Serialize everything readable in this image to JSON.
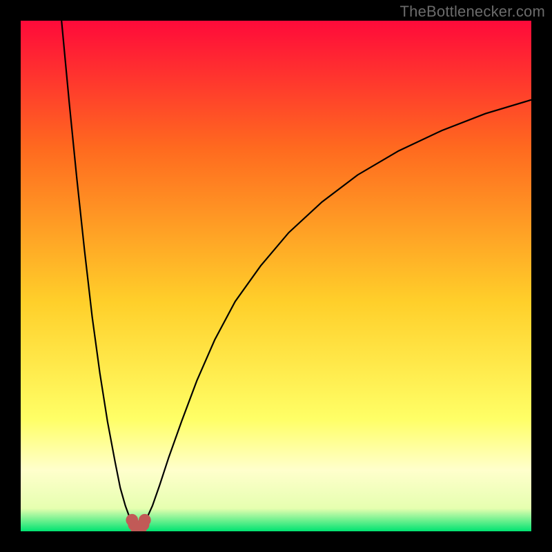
{
  "watermark": "TheBottlenecker.com",
  "colors": {
    "bg": "#000000",
    "gradient_top": "#ff0a3a",
    "gradient_mid_upper": "#ff6a1f",
    "gradient_mid": "#ffcf2a",
    "gradient_mid_lower": "#ffff66",
    "gradient_band": "#ffffcc",
    "gradient_bottom": "#00e371",
    "curve": "#000000",
    "marker": "#c15a57"
  },
  "chart_data": {
    "type": "line",
    "title": "",
    "xlabel": "",
    "ylabel": "",
    "xlim": [
      0,
      100
    ],
    "ylim": [
      0,
      100
    ],
    "gradient_stops": [
      {
        "offset": 0.0,
        "color": "#ff0a3a"
      },
      {
        "offset": 0.25,
        "color": "#ff6a1f"
      },
      {
        "offset": 0.55,
        "color": "#ffcf2a"
      },
      {
        "offset": 0.78,
        "color": "#ffff66"
      },
      {
        "offset": 0.88,
        "color": "#ffffcc"
      },
      {
        "offset": 0.955,
        "color": "#e6ffb0"
      },
      {
        "offset": 1.0,
        "color": "#00e371"
      }
    ],
    "series": [
      {
        "name": "left-branch",
        "x": [
          8.0,
          9.5,
          11.0,
          12.5,
          14.0,
          15.5,
          17.0,
          18.5,
          19.5,
          20.5,
          21.3,
          21.8
        ],
        "y": [
          100.0,
          84.0,
          69.0,
          55.0,
          42.0,
          31.0,
          21.5,
          13.5,
          8.5,
          5.0,
          2.8,
          2.2
        ]
      },
      {
        "name": "right-branch",
        "x": [
          24.3,
          24.8,
          25.8,
          27.2,
          29.0,
          31.5,
          34.5,
          38.0,
          42.0,
          47.0,
          52.5,
          59.0,
          66.0,
          74.0,
          82.5,
          91.0,
          100.0
        ],
        "y": [
          2.2,
          2.8,
          5.0,
          9.0,
          14.5,
          21.5,
          29.5,
          37.5,
          45.0,
          52.0,
          58.5,
          64.5,
          69.8,
          74.5,
          78.5,
          81.8,
          84.5
        ]
      }
    ],
    "markers": [
      {
        "name": "left-endpoint",
        "x": 21.8,
        "y": 2.2
      },
      {
        "name": "u-left",
        "x": 22.2,
        "y": 1.3
      },
      {
        "name": "u-mid-left",
        "x": 22.7,
        "y": 0.6
      },
      {
        "name": "u-bottom",
        "x": 23.1,
        "y": 0.4
      },
      {
        "name": "u-mid-right",
        "x": 23.5,
        "y": 0.6
      },
      {
        "name": "u-right",
        "x": 24.0,
        "y": 1.3
      },
      {
        "name": "right-endpoint",
        "x": 24.3,
        "y": 2.2
      }
    ],
    "marker_radius": 1.2
  }
}
